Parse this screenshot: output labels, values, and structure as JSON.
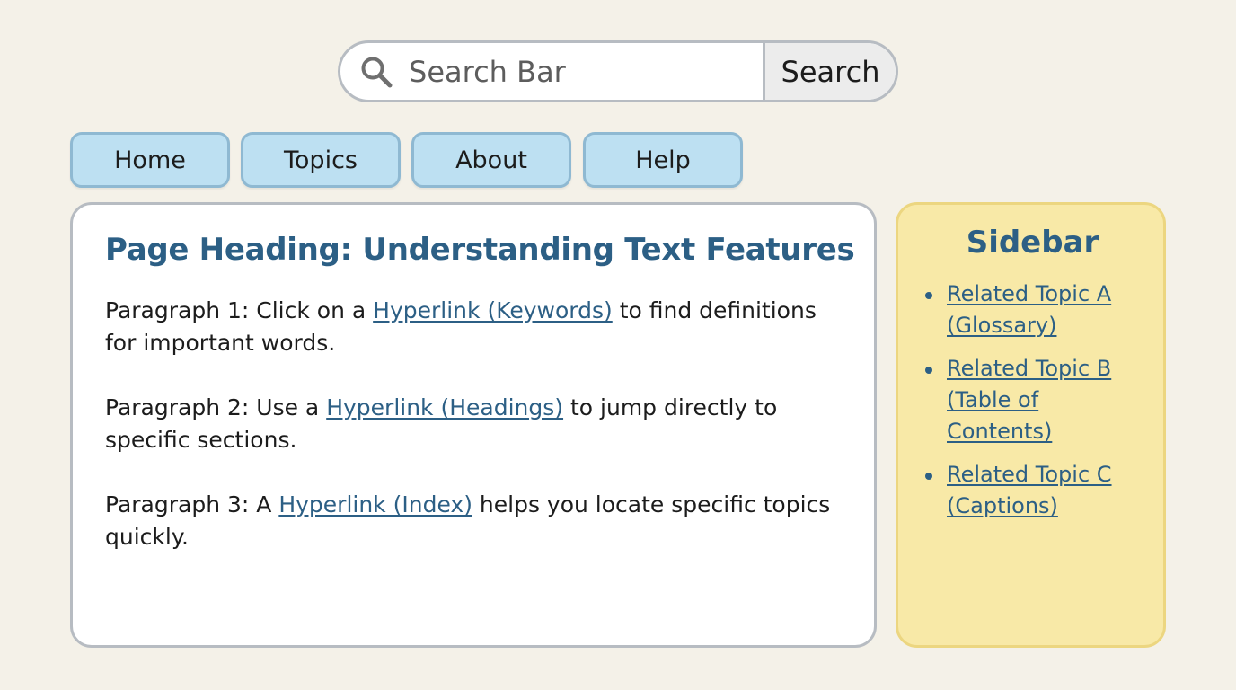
{
  "search": {
    "placeholder": "Search Bar",
    "button_label": "Search"
  },
  "nav": {
    "items": [
      {
        "label": "Home"
      },
      {
        "label": "Topics"
      },
      {
        "label": "About"
      },
      {
        "label": "Help"
      }
    ]
  },
  "main": {
    "title": "Page Heading: Understanding Text Features",
    "paragraphs": [
      {
        "before": "Paragraph 1: Click on a ",
        "link": "Hyperlink (Keywords)",
        "after": " to find definitions for important words."
      },
      {
        "before": "Paragraph 2: Use a ",
        "link": "Hyperlink (Headings)",
        "after": " to jump directly to specific sections."
      },
      {
        "before": "Paragraph 3: A ",
        "link": "Hyperlink (Index)",
        "after": " helps you locate specific topics quickly."
      }
    ]
  },
  "sidebar": {
    "title": "Sidebar",
    "links": [
      {
        "label": "Related Topic A (Glossary)"
      },
      {
        "label": "Related Topic B (Table of Contents)"
      },
      {
        "label": "Related Topic C (Captions)"
      }
    ]
  },
  "colors": {
    "page_background": "#f4f1e8",
    "heading": "#2c5f85",
    "link": "#2c5f85",
    "nav_button": "#bde0f2",
    "sidebar_background": "#f8e9a7"
  },
  "icons": {
    "search": "search-icon"
  }
}
